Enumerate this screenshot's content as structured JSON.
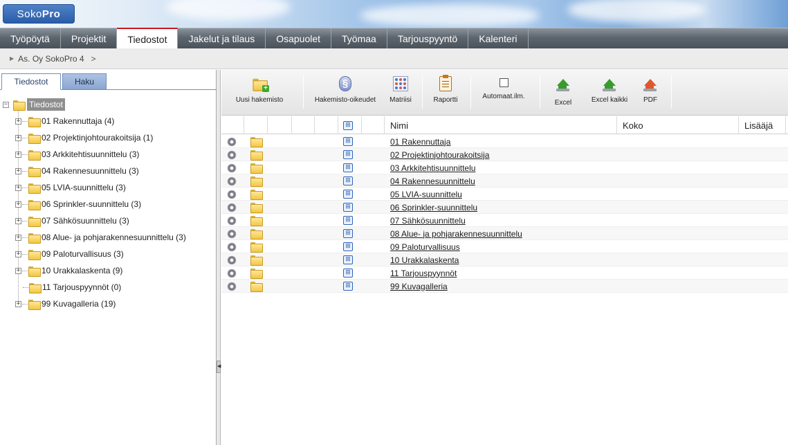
{
  "app": {
    "logo_text_light": "Soko",
    "logo_text_bold": "Pro",
    "accent_color": "#c8191e"
  },
  "nav": {
    "items": [
      {
        "label": "Työpöytä"
      },
      {
        "label": "Projektit"
      },
      {
        "label": "Tiedostot",
        "active": true
      },
      {
        "label": "Jakelut ja tilaus"
      },
      {
        "label": "Osapuolet"
      },
      {
        "label": "Työmaa"
      },
      {
        "label": "Tarjouspyyntö"
      },
      {
        "label": "Kalenteri"
      }
    ]
  },
  "breadcrumb": {
    "project": "As. Oy SokoPro 4",
    "separator": ">"
  },
  "left_tabs": {
    "files": "Tiedostot",
    "search": "Haku"
  },
  "tree": {
    "root_expander": "−",
    "root_label": "Tiedostot",
    "items": [
      {
        "label": "01 Rakennuttaja (4)",
        "expandable": true
      },
      {
        "label": "02 Projektinjohtourakoitsija (1)",
        "expandable": true
      },
      {
        "label": "03 Arkkitehtisuunnittelu (3)",
        "expandable": true
      },
      {
        "label": "04 Rakennesuunnittelu (3)",
        "expandable": true
      },
      {
        "label": "05 LVIA-suunnittelu (3)",
        "expandable": true
      },
      {
        "label": "06 Sprinkler-suunnittelu (3)",
        "expandable": true
      },
      {
        "label": "07 Sähkösuunnittelu (3)",
        "expandable": true
      },
      {
        "label": "08 Alue- ja pohjarakennesuunnittelu (3)",
        "expandable": true
      },
      {
        "label": "09 Paloturvallisuus (3)",
        "expandable": true
      },
      {
        "label": "10 Urakkalaskenta (9)",
        "expandable": true
      },
      {
        "label": "11 Tarjouspyynnöt (0)",
        "expandable": false
      },
      {
        "label": "99 Kuvagalleria (19)",
        "expandable": true
      }
    ]
  },
  "toolbar": {
    "new_folder": "Uusi hakemisto",
    "folder_permissions": "Hakemisto-oikeudet",
    "matrix": "Matriisi",
    "report": "Raportti",
    "auto_notify": "Automaat.ilm.",
    "excel": "Excel",
    "excel_all": "Excel kaikki",
    "pdf": "PDF"
  },
  "grid": {
    "columns": {
      "name": "Nimi",
      "size": "Koko",
      "added_by": "Lisääjä"
    },
    "rows": [
      {
        "name": "01 Rakennuttaja"
      },
      {
        "name": "02 Projektinjohtourakoitsija"
      },
      {
        "name": "03 Arkkitehtisuunnittelu"
      },
      {
        "name": "04 Rakennesuunnittelu"
      },
      {
        "name": "05 LVIA-suunnittelu"
      },
      {
        "name": "06 Sprinkler-suunnittelu"
      },
      {
        "name": "07 Sähkösuunnittelu"
      },
      {
        "name": "08 Alue- ja pohjarakennesuunnittelu"
      },
      {
        "name": "09 Paloturvallisuus"
      },
      {
        "name": "10 Urakkalaskenta"
      },
      {
        "name": "11 Tarjouspyynnöt"
      },
      {
        "name": "99 Kuvagalleria"
      }
    ]
  }
}
